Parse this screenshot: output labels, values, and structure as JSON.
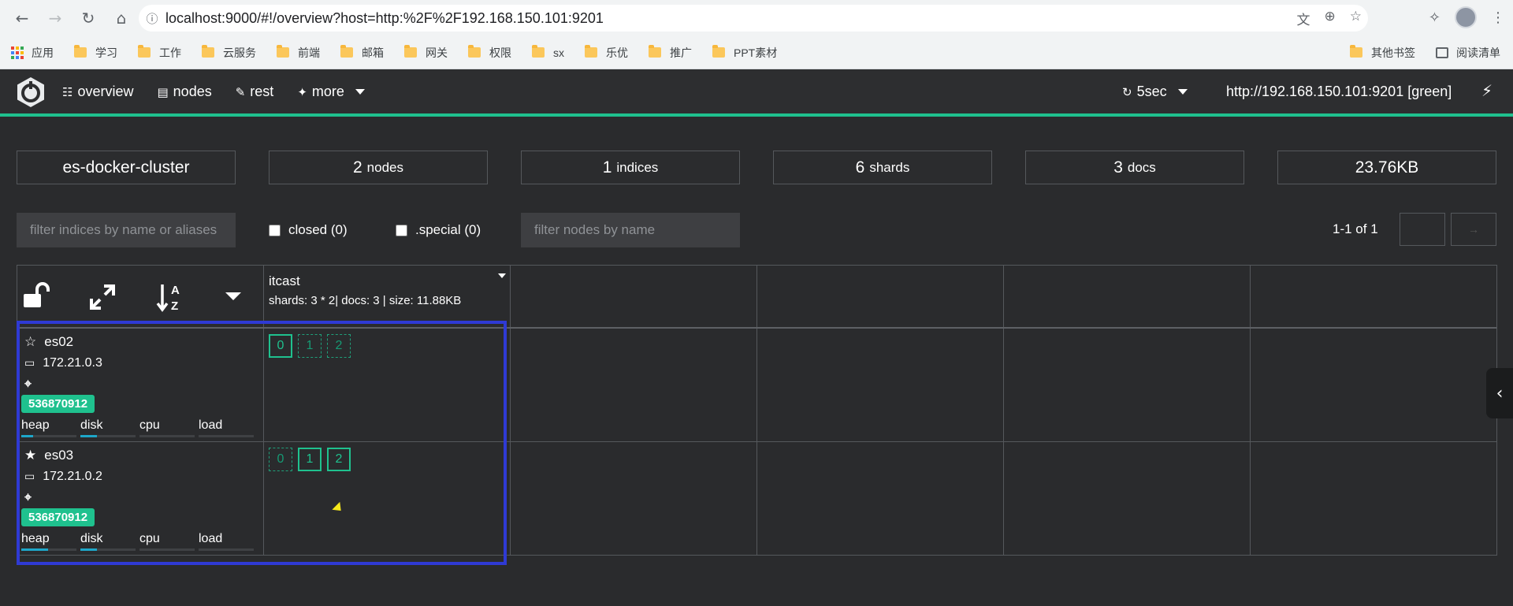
{
  "browser": {
    "url": "localhost:9000/#!/overview?host=http:%2F%2F192.168.150.101:9201",
    "bookmarks": [
      "应用",
      "学习",
      "工作",
      "云服务",
      "前端",
      "邮箱",
      "网关",
      "权限",
      "sx",
      "乐优",
      "推广",
      "PPT素材"
    ],
    "bookmarks_right": [
      "其他书签",
      "阅读清单"
    ]
  },
  "header": {
    "menu": [
      {
        "label": "overview",
        "icon": "sitemap-icon"
      },
      {
        "label": "nodes",
        "icon": "server-icon"
      },
      {
        "label": "rest",
        "icon": "edit-icon"
      },
      {
        "label": "more",
        "icon": "wand-icon"
      }
    ],
    "refresh": "5sec",
    "host": "http://192.168.150.101:9201 [green]"
  },
  "stats": {
    "cluster": "es-docker-cluster",
    "nodes_num": "2",
    "nodes_unit": "nodes",
    "indices_num": "1",
    "indices_unit": "indices",
    "shards_num": "6",
    "shards_unit": "shards",
    "docs_num": "3",
    "docs_unit": "docs",
    "size": "23.76KB"
  },
  "filters": {
    "indices_placeholder": "filter indices by name or aliases",
    "closed": "closed (0)",
    "special": ".special (0)",
    "nodes_placeholder": "filter nodes by name",
    "pagination": "1-1 of 1"
  },
  "index": {
    "name": "itcast",
    "meta": "shards: 3 * 2| docs: 3 | size: 11.88KB"
  },
  "nodes": [
    {
      "name": "es02",
      "ip": "172.21.0.3",
      "badge": "536870912",
      "master": false,
      "metrics": [
        {
          "label": "heap",
          "level": 0.22
        },
        {
          "label": "disk",
          "level": 0.3
        },
        {
          "label": "cpu",
          "level": 0
        },
        {
          "label": "load",
          "level": 0
        }
      ],
      "shards": [
        {
          "label": "0",
          "primary": true
        },
        {
          "label": "1",
          "primary": false
        },
        {
          "label": "2",
          "primary": false
        }
      ]
    },
    {
      "name": "es03",
      "ip": "172.21.0.2",
      "badge": "536870912",
      "master": true,
      "metrics": [
        {
          "label": "heap",
          "level": 0.48
        },
        {
          "label": "disk",
          "level": 0.3
        },
        {
          "label": "cpu",
          "level": 0
        },
        {
          "label": "load",
          "level": 0
        }
      ],
      "shards": [
        {
          "label": "0",
          "primary": false
        },
        {
          "label": "1",
          "primary": true
        },
        {
          "label": "2",
          "primary": true
        }
      ]
    }
  ],
  "colors": {
    "accent": "#1fc18e",
    "highlight": "#2f3ad4",
    "metric": "#1ea7c9"
  }
}
